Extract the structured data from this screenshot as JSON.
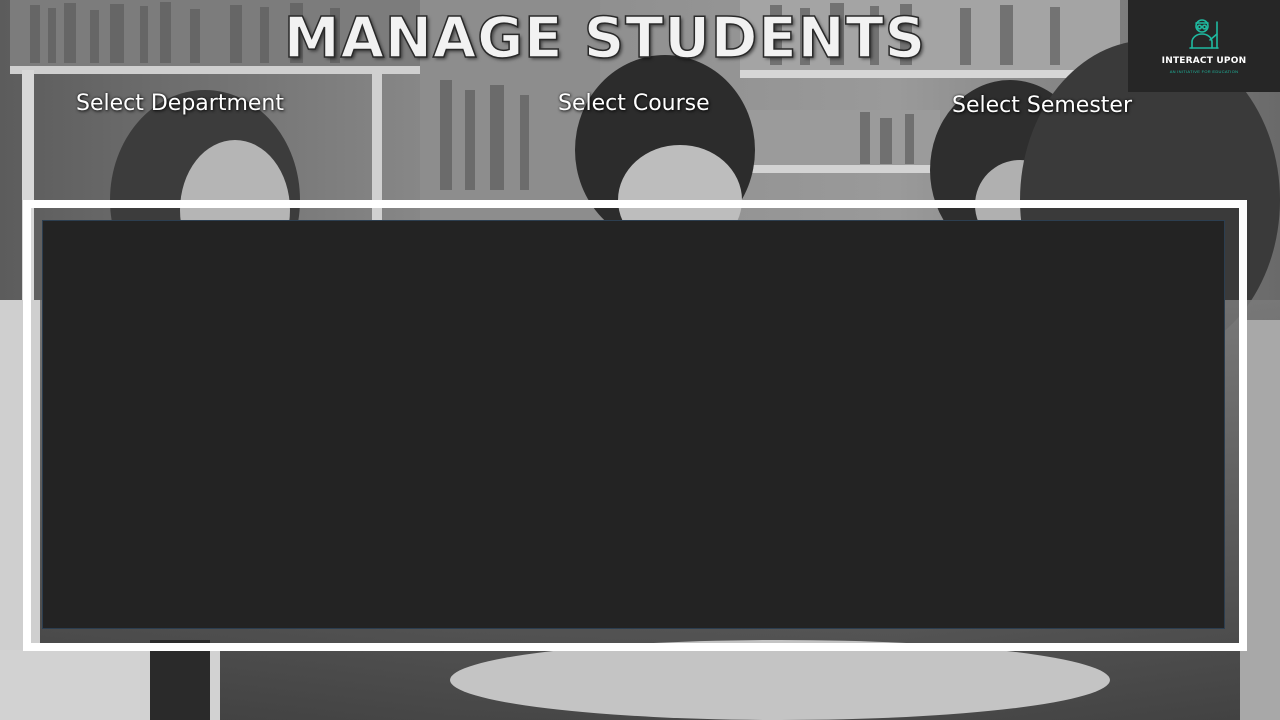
{
  "header": {
    "title": "MANAGE STUDENTS"
  },
  "filters": {
    "department_label": "Select Department",
    "course_label": "Select Course",
    "semester_label": "Select Semester"
  },
  "logo": {
    "name": "INTERACT UPON",
    "tagline": "AN INITIATIVE FOR EDUCATION",
    "icon": "teacher-at-board-icon",
    "accent_color": "#1fb9a0"
  },
  "main_panel": {
    "background_color": "#232323",
    "border_color": "#ffffff"
  }
}
